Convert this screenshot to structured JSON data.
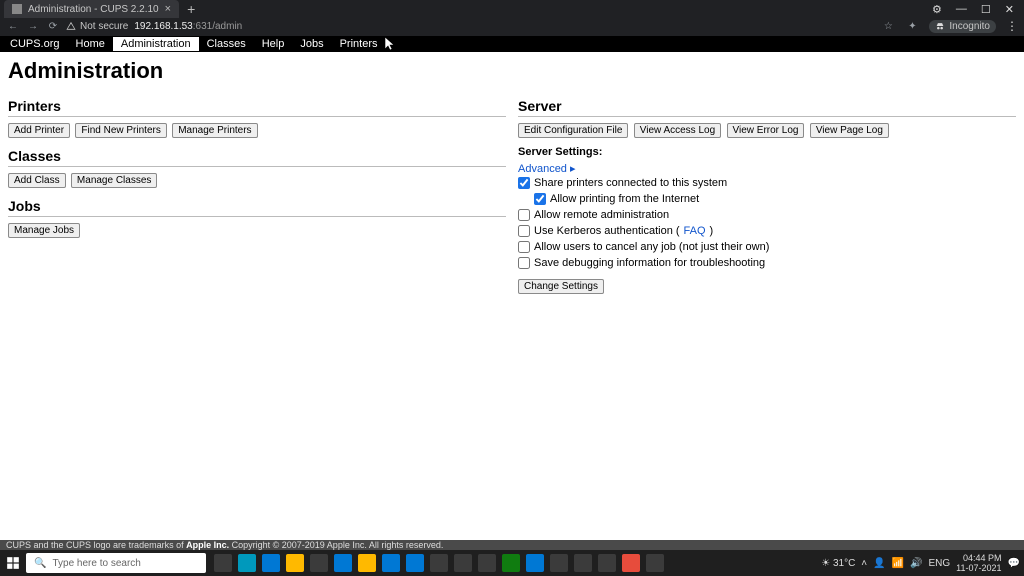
{
  "browser": {
    "tab_title": "Administration - CUPS 2.2.10",
    "insecure_label": "Not secure",
    "url_host": "192.168.1.53",
    "url_port_path": ":631/admin",
    "incognito_label": "Incognito"
  },
  "nav": {
    "items": [
      {
        "label": "CUPS.org",
        "active": false
      },
      {
        "label": "Home",
        "active": false
      },
      {
        "label": "Administration",
        "active": true
      },
      {
        "label": "Classes",
        "active": false
      },
      {
        "label": "Help",
        "active": false
      },
      {
        "label": "Jobs",
        "active": false
      },
      {
        "label": "Printers",
        "active": false
      }
    ]
  },
  "page_title": "Administration",
  "left": {
    "printers_heading": "Printers",
    "printers_buttons": {
      "add": "Add Printer",
      "find": "Find New Printers",
      "manage": "Manage Printers"
    },
    "classes_heading": "Classes",
    "classes_buttons": {
      "add": "Add Class",
      "manage": "Manage Classes"
    },
    "jobs_heading": "Jobs",
    "jobs_buttons": {
      "manage": "Manage Jobs"
    }
  },
  "right": {
    "server_heading": "Server",
    "server_buttons": {
      "edit": "Edit Configuration File",
      "access": "View Access Log",
      "error": "View Error Log",
      "page": "View Page Log"
    },
    "settings_label": "Server Settings:",
    "advanced_label": "Advanced ▸",
    "share_label": "Share printers connected to this system",
    "allow_internet_label": "Allow printing from the Internet",
    "allow_remote_label": "Allow remote administration",
    "kerberos_prefix": "Use Kerberos authentication (",
    "faq_label": "FAQ",
    "kerberos_suffix": ")",
    "cancel_any_label": "Allow users to cancel any job (not just their own)",
    "debug_label": "Save debugging information for troubleshooting",
    "change_button": "Change Settings"
  },
  "footer": {
    "prefix": "CUPS and the CUPS logo are trademarks of ",
    "brand": "Apple Inc.",
    "suffix": " Copyright © 2007-2019 Apple Inc. All rights reserved."
  },
  "taskbar": {
    "search_placeholder": "Type here to search",
    "weather": "31°C",
    "lang": "ENG",
    "time": "04:44 PM",
    "date": "11-07-2021"
  }
}
